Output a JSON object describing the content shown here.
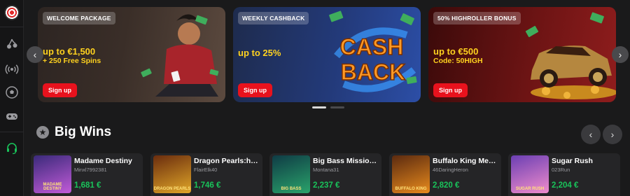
{
  "sidebar": {
    "icons": [
      "dartboard-logo-icon",
      "cherries-icon",
      "live-broadcast-icon",
      "football-icon",
      "gamepad-icon",
      "support-headset-icon"
    ]
  },
  "banners": [
    {
      "tag": "WELCOME PACKAGE",
      "headline": "up to €1,500",
      "subline": "+ 250 Free Spins",
      "button": "Sign up"
    },
    {
      "tag": "WEEKLY CASHBACK",
      "headline": "up to 25%",
      "subline": "",
      "button": "Sign up",
      "art_text_1": "CASH",
      "art_text_2": "BACK"
    },
    {
      "tag": "50% HIGHROLLER BONUS",
      "headline": "up to €500",
      "subline": "Code: 50HIGH",
      "button": "Sign up"
    }
  ],
  "carousel": {
    "prev": "‹",
    "next": "›",
    "slides": 2,
    "active": 0
  },
  "big_wins": {
    "title": "Big Wins",
    "prev": "‹",
    "next": "›",
    "items": [
      {
        "game": "Madame Destiny",
        "user": "Minxl7992381",
        "amount": "1,681 €",
        "thumb_label": "MADAME DESTINY",
        "colors": [
          "#3a2a7a",
          "#c25bd8"
        ]
      },
      {
        "game": "Dragon Pearls:hold & win",
        "user": "FlairElk40",
        "amount": "1,746 €",
        "thumb_label": "DRAGON PEARLS",
        "colors": [
          "#6a2c0e",
          "#e0a628"
        ]
      },
      {
        "game": "Big Bass Mission Fishin'",
        "user": "Montana31",
        "amount": "2,237 €",
        "thumb_label": "BIG BASS",
        "colors": [
          "#0f3b45",
          "#2aa36b"
        ]
      },
      {
        "game": "Buffalo King Megaways",
        "user": "46DaringHeron",
        "amount": "2,820 €",
        "thumb_label": "BUFFALO KING",
        "colors": [
          "#5b2a10",
          "#e88a1c"
        ]
      },
      {
        "game": "Sugar Rush",
        "user": "023Run",
        "amount": "2,204 €",
        "thumb_label": "SUGAR RUSH",
        "colors": [
          "#6b3fb3",
          "#f08ccc"
        ]
      }
    ]
  }
}
